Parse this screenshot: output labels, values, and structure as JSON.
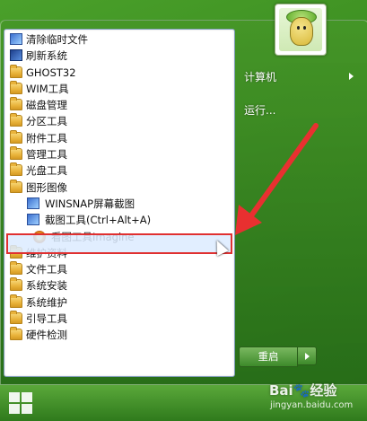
{
  "start_menu": {
    "programs": [
      {
        "label": "清除临时文件",
        "icon": "app-icon",
        "indent": false,
        "selected": false
      },
      {
        "label": "刷新系统",
        "icon": "app-icon-dark",
        "indent": false,
        "selected": false
      },
      {
        "label": "GHOST32",
        "icon": "folder-icon",
        "indent": false,
        "selected": false
      },
      {
        "label": "WIM工具",
        "icon": "folder-icon",
        "indent": false,
        "selected": false
      },
      {
        "label": "磁盘管理",
        "icon": "folder-icon",
        "indent": false,
        "selected": false
      },
      {
        "label": "分区工具",
        "icon": "folder-icon",
        "indent": false,
        "selected": false
      },
      {
        "label": "附件工具",
        "icon": "folder-icon",
        "indent": false,
        "selected": false
      },
      {
        "label": "管理工具",
        "icon": "folder-icon",
        "indent": false,
        "selected": false
      },
      {
        "label": "光盘工具",
        "icon": "folder-icon",
        "indent": false,
        "selected": false
      },
      {
        "label": "图形图像",
        "icon": "folder-icon",
        "indent": false,
        "selected": false
      },
      {
        "label": "WINSNAP屏幕截图",
        "icon": "app-icon",
        "indent": true,
        "selected": false
      },
      {
        "label": "截图工具(Ctrl+Alt+A)",
        "icon": "app-icon",
        "indent": true,
        "selected": false
      },
      {
        "label": "看图工具Imagine",
        "icon": "imagine-icon",
        "indent": true,
        "selected": true
      },
      {
        "label": "维护资料",
        "icon": "folder-icon",
        "indent": false,
        "selected": false
      },
      {
        "label": "文件工具",
        "icon": "folder-icon",
        "indent": false,
        "selected": false
      },
      {
        "label": "系统安装",
        "icon": "folder-icon",
        "indent": false,
        "selected": false
      },
      {
        "label": "系统维护",
        "icon": "folder-icon",
        "indent": false,
        "selected": false
      },
      {
        "label": "引导工具",
        "icon": "folder-icon",
        "indent": false,
        "selected": false
      },
      {
        "label": "硬件检测",
        "icon": "folder-icon",
        "indent": false,
        "selected": false
      }
    ],
    "right_items": {
      "computer": "计算机",
      "run": "运行..."
    },
    "restart_label": "重启",
    "highlight_color": "#e03030",
    "annotation_arrow_color": "#e83030"
  },
  "watermark": {
    "brand": "Bai🐾经验",
    "url": "jingyan.baidu.com"
  }
}
